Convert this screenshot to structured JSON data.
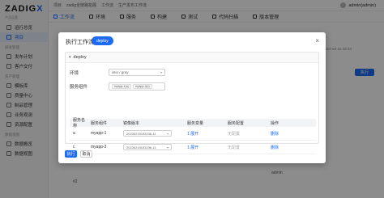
{
  "app": {
    "logo": "ZADIGX",
    "logo_accent": "X",
    "logo_main": "ZADIG",
    "subtitle": "产品运营",
    "accent_color": "#1e6bf1"
  },
  "sidebar": {
    "items": [
      {
        "label": "运行总览",
        "icon": "dashboard-icon",
        "active": false
      },
      {
        "label": "项目",
        "icon": "project-icon",
        "active": true
      }
    ],
    "groups": [
      {
        "title": "研发管理",
        "items": [
          {
            "label": "发布计划",
            "icon": "calendar-icon"
          },
          {
            "label": "客户交付",
            "icon": "delivery-icon"
          }
        ]
      },
      {
        "title": "资产管理",
        "items": [
          {
            "label": "模板库",
            "icon": "template-icon"
          },
          {
            "label": "质量中心",
            "icon": "quality-icon"
          },
          {
            "label": "制品管理",
            "icon": "artifact-icon"
          },
          {
            "label": "业务观测",
            "icon": "monitor-icon"
          },
          {
            "label": "资源配置",
            "icon": "resource-icon"
          }
        ]
      },
      {
        "title": "数据视图",
        "items": [
          {
            "label": "数据概览",
            "icon": "chart-icon"
          },
          {
            "label": "数据视图",
            "icon": "view-icon"
          }
        ]
      }
    ]
  },
  "topbar": {
    "crumbs": [
      "项目",
      "zadig全链路拓展",
      "工作流",
      "生产发布工作流"
    ],
    "user": "admin(admin)"
  },
  "tabs": [
    {
      "label": "工作流",
      "active": true
    },
    {
      "label": "环境",
      "active": false
    },
    {
      "label": "服务",
      "active": false
    },
    {
      "label": "构建",
      "active": false
    },
    {
      "label": "测试",
      "active": false
    },
    {
      "label": "代码扫描",
      "active": false
    },
    {
      "label": "版本管理",
      "active": false
    }
  ],
  "background": {
    "date": "2023-02-15 10:33",
    "button": "执行",
    "rows": [
      "#2",
      "admin"
    ]
  },
  "modal": {
    "title": "执行工作流",
    "tag": "deploy",
    "close": "×",
    "panel_title": "deploy",
    "env_label": "环境",
    "env_value": "istio / gray",
    "services_label": "服务组件",
    "service_chips": [
      "myapp-1(a)",
      "myapp-3(c)"
    ],
    "table": {
      "headers": [
        "服务名称",
        "服务组件",
        "镜像版本",
        "服务变量",
        "服务配置",
        "操作"
      ],
      "rows": [
        {
          "name": "a",
          "component": "myapp-1",
          "image": "20230215153236-11",
          "vars": "1 展开",
          "config": "无配置",
          "action": "删除"
        },
        {
          "name": "c",
          "component": "myapp-3",
          "image": "20230215153236-11",
          "vars": "1 展开",
          "config": "无配置",
          "action": "删除"
        }
      ]
    },
    "run_button": "执行",
    "cancel_button": "取消"
  }
}
